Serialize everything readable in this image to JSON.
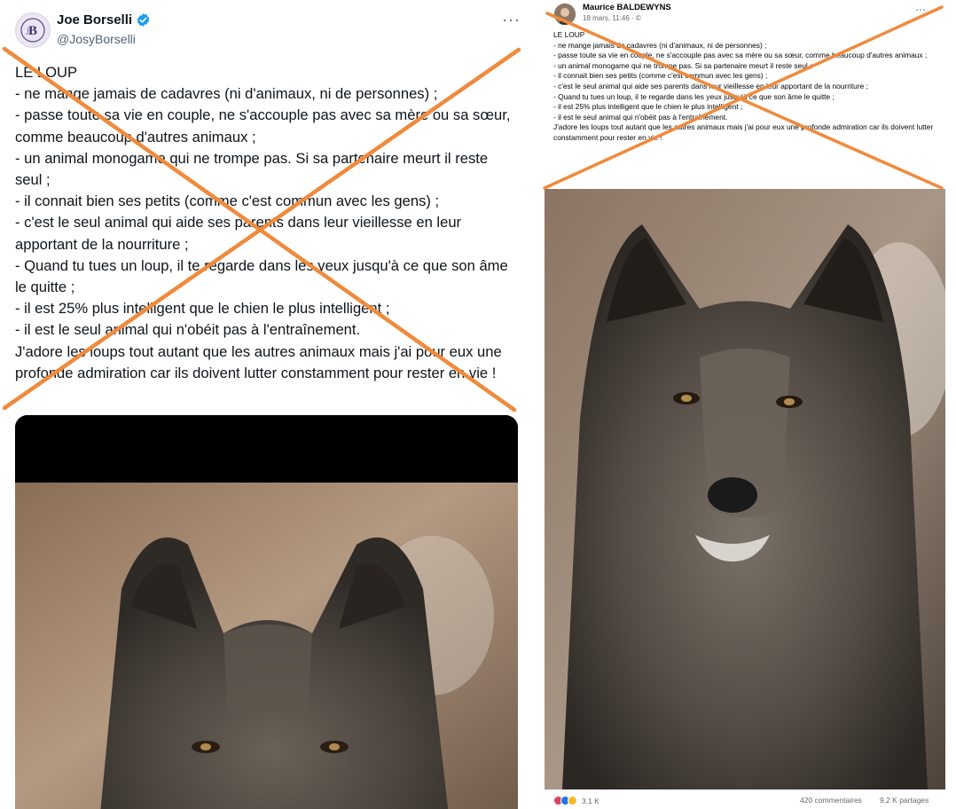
{
  "twitter_post": {
    "author_name": "Joe Borselli",
    "handle": "@JosyBorselli",
    "more_glyph": "···",
    "lines": [
      "LE LOUP",
      "- ne mange jamais de cadavres (ni d'animaux, ni de personnes) ;",
      "- passe toute sa vie en couple, ne s'accouple pas avec sa mère ou sa sœur, comme beaucoup d'autres animaux ;",
      "- un animal monogame qui ne trompe pas. Si sa partenaire meurt il reste seul ;",
      "- il connait bien ses petits (comme c'est commun avec les gens) ;",
      "- c'est le seul animal qui aide ses parents dans leur vieillesse en leur apportant de la nourriture ;",
      "- Quand tu tues un loup, il te regarde dans les yeux jusqu'à ce que son âme le quitte ;",
      "- il est 25% plus intelligent que le chien le plus intelligent ;",
      "- il est le seul animal qui n'obéit pas à l'entraînement.",
      "J'adore les loups tout autant que les autres animaux mais j'ai pour eux une profonde admiration car ils doivent lutter constamment pour rester en vie !"
    ]
  },
  "facebook_post": {
    "author_name": "Maurice BALDEWYNS",
    "meta": "18 mars, 11:46 · ©",
    "lines": [
      "LE LOUP",
      "- ne mange jamais de cadavres (ni d'animaux, ni de personnes) ;",
      "- passe toute sa vie en couple, ne s'accouple pas avec sa mère ou sa sœur, comme beaucoup d'autres animaux ;",
      "- un animal monogame qui ne trompe pas. Si sa partenaire meurt il reste seul ;",
      "- il connait bien ses petits (comme c'est commun avec les gens) ;",
      "- c'est le seul animal qui aide ses parents dans leur vieillesse en leur      apportant de la nourriture ;",
      "- Quand tu tues un loup, il te regarde dans les yeux jusqu'à ce que son âme le quitte ;",
      "- il est 25% plus intelligent que le chien le plus intelligent ;",
      "- il est le seul animal qui n'obéit pas à l'entraînement.",
      "J'adore les loups tout autant que les autres animaux mais j'ai pour eux une profonde admiration car ils doivent lutter constamment pour rester en vie !"
    ],
    "reactions_count": "3,1 K",
    "comments": "420 commentaires",
    "shares": "9,2 K partages"
  },
  "colors": {
    "cross": "#f08a3c",
    "twitter_text": "#0f1419",
    "twitter_muted": "#536471",
    "verified": "#1d9bf0",
    "facebook_muted": "#65676b"
  },
  "icons": [
    "verified-badge-icon",
    "more-options-icon",
    "like-reaction-icon",
    "love-reaction-icon",
    "haha-reaction-icon",
    "globe-icon"
  ]
}
